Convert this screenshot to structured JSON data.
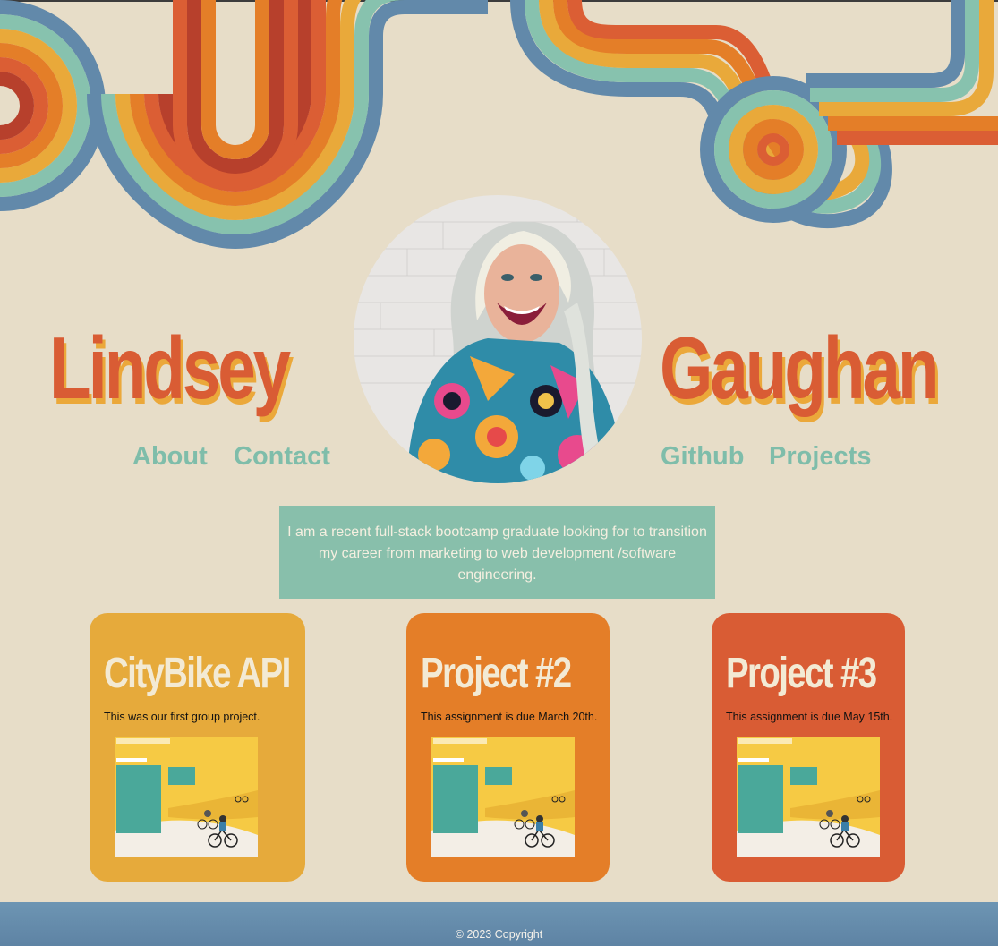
{
  "header": {
    "first_name": "Lindsey",
    "last_name": "Gaughan"
  },
  "nav": {
    "left": [
      {
        "label": "About"
      },
      {
        "label": "Contact"
      }
    ],
    "right": [
      {
        "label": "Github"
      },
      {
        "label": "Projects"
      }
    ]
  },
  "bio": {
    "text": "I am a recent full-stack bootcamp graduate looking for to transition my career from marketing to web development /software engineering."
  },
  "projects": [
    {
      "title": "CityBike API",
      "description": "This was our first group project.",
      "color": "#e6aa3b"
    },
    {
      "title": "Project #2",
      "description": "This assignment is due March 20th.",
      "color": "#e47e28"
    },
    {
      "title": "Project #3",
      "description": "This assignment is due May 15th.",
      "color": "#d95c34"
    }
  ],
  "footer": {
    "copyright": "© 2023 Copyright"
  },
  "colors": {
    "background": "#e7ddc8",
    "name": "#d95c34",
    "name_shadow": "#eba83a",
    "nav": "#7fbdaa",
    "bio_bg": "#88bfab",
    "footer": "#6289aa",
    "stripe_blue": "#6289aa",
    "stripe_teal": "#87c2ae",
    "stripe_yellow": "#e9a93a",
    "stripe_orange": "#e47e28",
    "stripe_red_orange": "#db5e34",
    "stripe_red": "#b7402c"
  }
}
